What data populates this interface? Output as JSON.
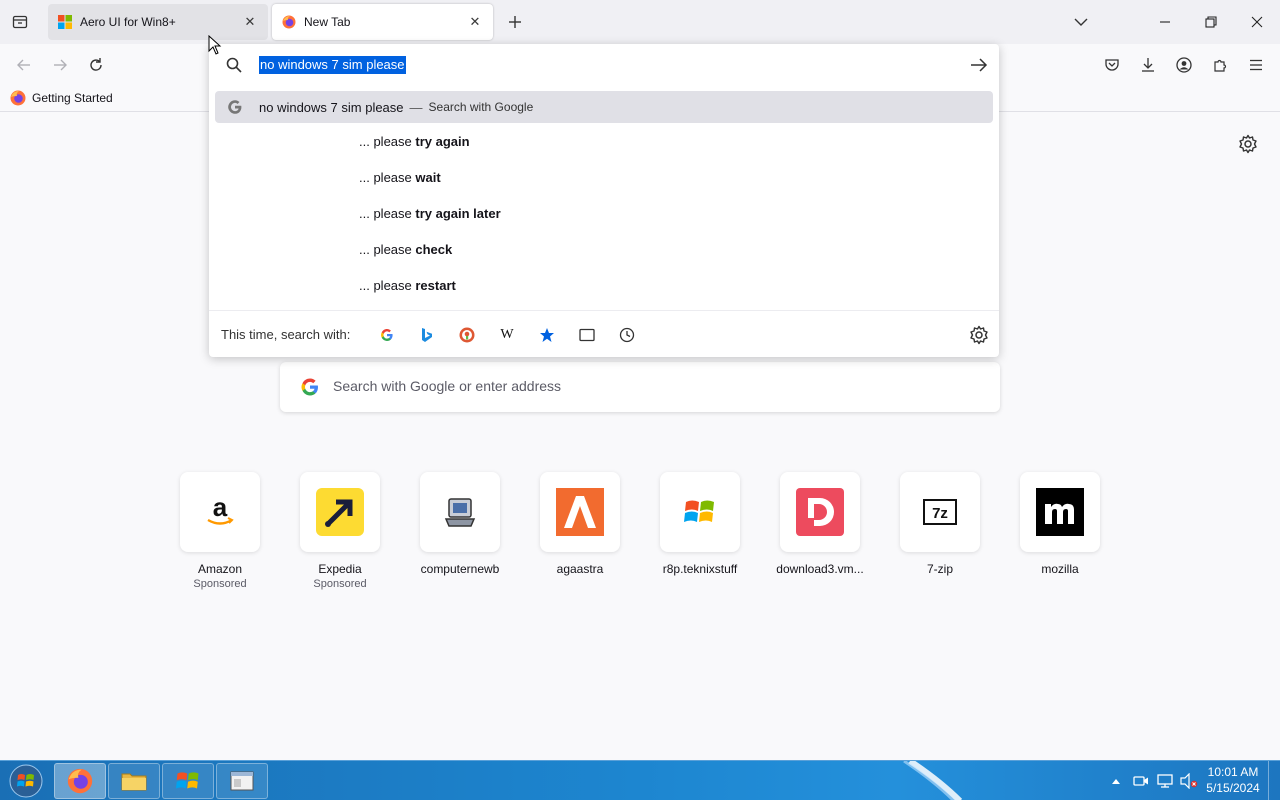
{
  "tabs": [
    {
      "title": "Aero UI for Win8+",
      "favicon": "windows-flag-icon",
      "active": false
    },
    {
      "title": "New Tab",
      "favicon": "firefox-icon",
      "active": true
    }
  ],
  "toolbar": {
    "icons": [
      "back-icon",
      "forward-icon",
      "reload-icon",
      "pocket-icon",
      "download-icon",
      "account-icon",
      "extensions-icon",
      "menu-icon"
    ]
  },
  "bookmarks": [
    {
      "label": "Getting Started",
      "icon": "firefox-icon"
    }
  ],
  "urlbar": {
    "value": "no windows 7 sim please",
    "heuristic": {
      "text": "no windows 7 sim please",
      "separator": "—",
      "action": "Search with Google"
    },
    "suggestions": [
      {
        "prefix": "... please ",
        "bold": "try again"
      },
      {
        "prefix": "... please ",
        "bold": "wait"
      },
      {
        "prefix": "... please ",
        "bold": "try again later"
      },
      {
        "prefix": "... please ",
        "bold": "check"
      },
      {
        "prefix": "... please ",
        "bold": "restart"
      }
    ],
    "oneoff_label": "This time, search with:",
    "oneoff_engines": [
      "google-icon",
      "bing-icon",
      "duckduckgo-icon",
      "wikipedia-icon",
      "bookmarks-star-icon",
      "tabs-icon",
      "history-icon"
    ]
  },
  "newtab": {
    "search_placeholder": "Search with Google or enter address",
    "shortcuts": [
      {
        "label": "Amazon",
        "sponsored": "Sponsored"
      },
      {
        "label": "Expedia",
        "sponsored": "Sponsored"
      },
      {
        "label": "computernewb",
        "sponsored": ""
      },
      {
        "label": "agaastra",
        "sponsored": ""
      },
      {
        "label": "r8p.teknixstuff",
        "sponsored": ""
      },
      {
        "label": "download3.vm...",
        "sponsored": ""
      },
      {
        "label": "7-zip",
        "sponsored": ""
      },
      {
        "label": "mozilla",
        "sponsored": ""
      }
    ]
  },
  "taskbar": {
    "time": "10:01 AM",
    "date": "5/15/2024"
  },
  "colors": {
    "selection": "#0061e0",
    "taskbar": "#1d86d0"
  }
}
